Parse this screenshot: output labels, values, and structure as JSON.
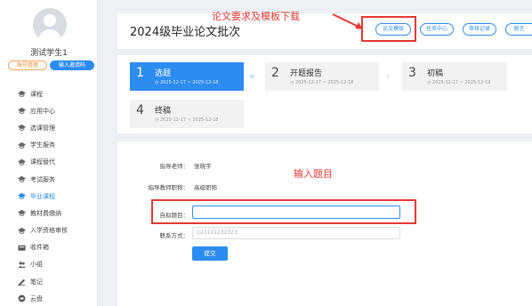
{
  "user": {
    "name": "测试学生1"
  },
  "sidebar": {
    "pill_account": "账号管理",
    "pill_invite": "输入邀请码",
    "items": [
      {
        "label": "课程",
        "icon": "graduation-cap-icon",
        "active": false
      },
      {
        "label": "应用中心",
        "icon": "graduation-cap-icon",
        "active": false
      },
      {
        "label": "选课管理",
        "icon": "graduation-cap-icon",
        "active": false
      },
      {
        "label": "学生服务",
        "icon": "graduation-cap-icon",
        "active": false
      },
      {
        "label": "课程替代",
        "icon": "graduation-cap-icon",
        "active": false
      },
      {
        "label": "考试服务",
        "icon": "graduation-cap-icon",
        "active": false
      },
      {
        "label": "毕业课程",
        "icon": "graduation-cap-icon",
        "active": true
      },
      {
        "label": "教材费缴纳",
        "icon": "graduation-cap-icon",
        "active": false
      },
      {
        "label": "入学资格审核",
        "icon": "graduation-cap-icon",
        "active": false
      },
      {
        "label": "收件箱",
        "icon": "inbox-icon",
        "active": false
      },
      {
        "label": "小组",
        "icon": "group-icon",
        "active": false
      },
      {
        "label": "笔记",
        "icon": "note-icon",
        "active": false
      },
      {
        "label": "云盘",
        "icon": "cloud-icon",
        "active": false
      }
    ]
  },
  "header": {
    "title": "2024级毕业论文批次",
    "buttons": [
      "论文模版",
      "任务中心",
      "审核记录",
      "留言"
    ],
    "annotation": "论文要求及模板下载"
  },
  "steps": [
    {
      "num": "1",
      "label": "选题",
      "dates": "◷ 2025-12-17 ~ 2025-12-18",
      "active": true
    },
    {
      "num": "2",
      "label": "开题报告",
      "dates": "◷ 2025-12-17 ~ 2025-12-18",
      "active": false
    },
    {
      "num": "3",
      "label": "初稿",
      "dates": "◷ 2025-12-17 ~ 2025-12-19",
      "active": false
    },
    {
      "num": "4",
      "label": "终稿",
      "dates": "◷ 2025-12-17 ~ 2025-12-18",
      "active": false
    }
  ],
  "form": {
    "advisor_label": "指导老师：",
    "advisor_value": "张晓宇",
    "title_rank_label": "指导教师职称：",
    "title_rank_value": "高级职称",
    "topic_label": "自拟题目：",
    "topic_value": "",
    "contact_label": "联系方式：",
    "contact_placeholder": "123121232323",
    "submit_label": "提交",
    "annotation": "输入题目"
  },
  "colors": {
    "accent": "#2d8cf0",
    "annotation": "#e53935"
  }
}
